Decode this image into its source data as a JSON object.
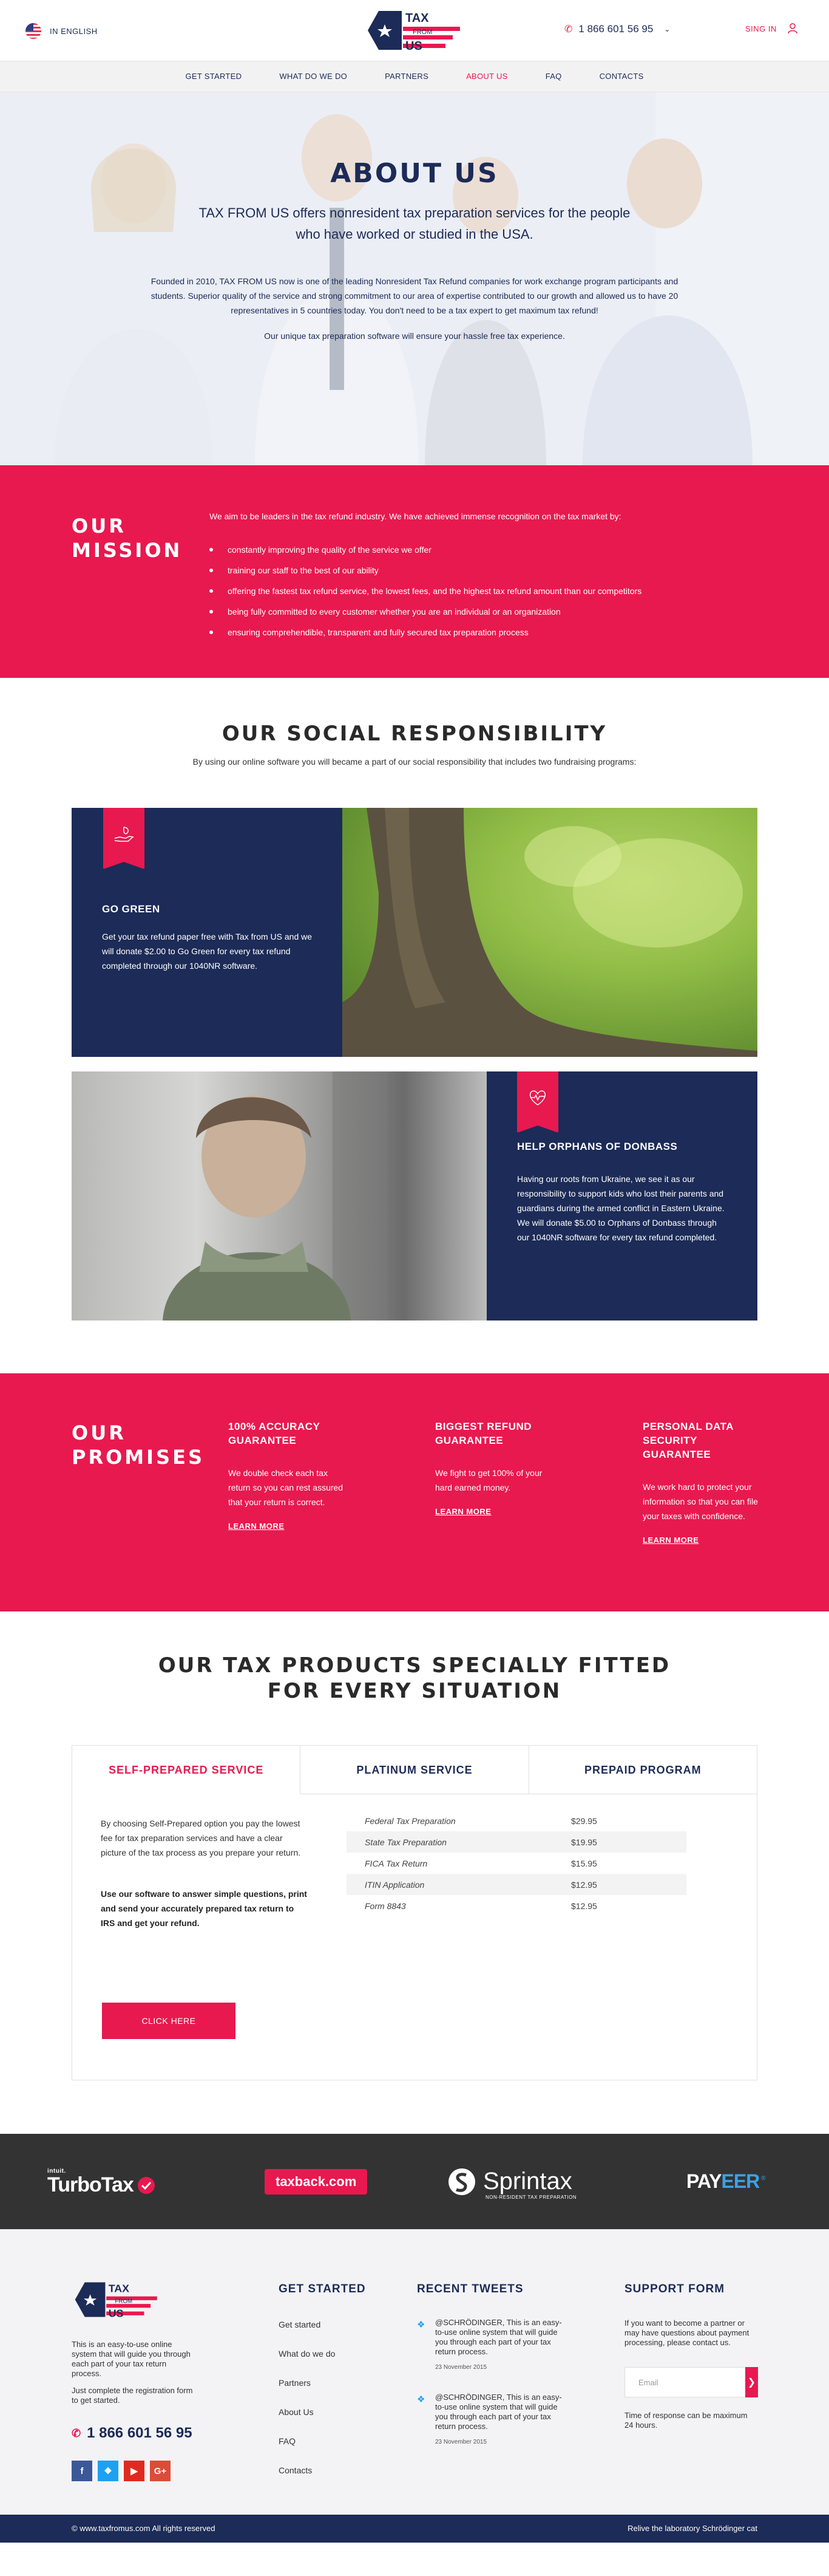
{
  "header": {
    "language": "IN ENGLISH",
    "logo": {
      "line1": "TAX",
      "line2": "FROM",
      "line3": "US"
    },
    "phone": "1 866 601 56 95",
    "sign_in": "SING IN"
  },
  "nav": {
    "items": [
      "GET STARTED",
      "WHAT DO WE DO",
      "PARTNERS",
      "ABOUT US",
      "FAQ",
      "CONTACTS"
    ],
    "active": "ABOUT US"
  },
  "hero": {
    "title": "ABOUT US",
    "lead": "TAX FROM US offers nonresident tax preparation services for the people who have worked or studied in the USA.",
    "paragraph": "Founded in 2010, TAX FROM US now is one of the leading Nonresident Tax Refund companies for work exchange program participants and students. Superior quality of the service and strong commitment to our area of expertise contributed to our growth and allowed us to have 20 representatives in 5 countries today. You don't need to be a tax expert to get maximum tax refund!",
    "paragraph2": "Our unique tax preparation software will ensure your hassle free tax experience."
  },
  "mission": {
    "title_line1": "OUR",
    "title_line2": "MISSION",
    "intro": "We aim to be leaders in the tax refund industry. We have achieved immense recognition on the tax market by:",
    "items": [
      "constantly improving the quality of the service we offer",
      "training our staff to the best of our ability",
      "offering the fastest tax refund service, the lowest fees, and the highest tax refund amount than our competitors",
      "being fully committed to every customer whether you are an individual or an organization",
      "ensuring comprehendible, transparent and fully secured tax preparation process"
    ]
  },
  "social": {
    "title": "OUR SOCIAL RESPONSIBILITY",
    "subtitle": "By using our online software you will became a part of our social responsibility that includes two fundraising programs:",
    "programs": [
      {
        "title": "GO GREEN",
        "text": "Get your tax refund paper free with Tax from US and we will donate $2.00 to Go Green for every tax refund completed through our 1040NR software."
      },
      {
        "title": "HELP ORPHANS OF DONBASS",
        "text": "Having our roots from Ukraine, we see it as our responsibility to support kids who lost their parents and guardians during the armed conflict in Eastern Ukraine. We will donate $5.00 to Orphans of Donbass through our 1040NR software for every tax refund completed."
      }
    ]
  },
  "promises": {
    "title_line1": "OUR",
    "title_line2": "PROMISES",
    "items": [
      {
        "title": "100% ACCURACY GUARANTEE",
        "text": "We double check each tax return so you can rest assured that your return is correct.",
        "link": "LEARN MORE"
      },
      {
        "title": "BIGGEST REFUND GUARANTEE",
        "text": "We fight to get 100% of your hard earned money.",
        "link": "LEARN MORE"
      },
      {
        "title": "PERSONAL DATA SECURITY GUARANTEE",
        "text": "We work hard to protect your information so that you can file your taxes with confidence.",
        "link": "LEARN MORE"
      }
    ]
  },
  "products": {
    "title_line1": "OUR TAX PRODUCTS SPECIALLY FITTED",
    "title_line2": "FOR EVERY SITUATION",
    "tabs": [
      "SELF-PREPARED SERVICE",
      "PLATINUM SERVICE",
      "PREPAID PROGRAM"
    ],
    "active_tab": "SELF-PREPARED SERVICE",
    "description": "By choosing Self-Prepared option you pay the lowest fee for tax preparation services and have a clear picture of the tax process as you prepare your return.",
    "description_bold": "Use our software to answer simple questions, print and send your accurately prepared tax return to IRS and get your refund.",
    "prices": [
      {
        "name": "Federal Tax Preparation",
        "price": "$29.95"
      },
      {
        "name": "State Tax Preparation",
        "price": "$19.95"
      },
      {
        "name": "FICA Tax Return",
        "price": "$15.95"
      },
      {
        "name": "ITIN Application",
        "price": "$12.95"
      },
      {
        "name": "Form 8843",
        "price": "$12.95"
      }
    ],
    "button": "CLICK HERE"
  },
  "partners": {
    "turbotax": {
      "prefix": "intuit.",
      "name": "TurboTax"
    },
    "taxback": "taxback.com",
    "sprintax": {
      "name": "Sprintax",
      "tagline": "NON-RESIDENT TAX PREPARATION"
    },
    "payeer": {
      "pay": "PAY",
      "eer": "EER"
    }
  },
  "footer": {
    "about": "This is an easy-to-use online system that will guide you through each part of your tax return process.",
    "note": "Just complete the registration form to get started.",
    "phone": "1 866 601 56 95",
    "get_started": {
      "title": "GET STARTED",
      "links": [
        "Get started",
        "What do we do",
        "Partners",
        "About Us",
        "FAQ",
        "Contacts"
      ]
    },
    "tweets": {
      "title": "RECENT TWEETS",
      "items": [
        {
          "text": "@SCHRÖDINGER, This is an easy-to-use online system that will guide you through each part of your tax return process.",
          "date": "23 November 2015"
        },
        {
          "text": "@SCHRÖDINGER, This is an easy-to-use online system that will guide you through each part of your tax return process.",
          "date": "23 November 2015"
        }
      ]
    },
    "support": {
      "title": "SUPPORT FORM",
      "desc": "If you want to become a partner or may have questions about payment processing, please contact us.",
      "email_placeholder": "Email",
      "time": "Time of response can be maximum 24 hours."
    },
    "copyright": "© www.taxfromus.com All rights reserved",
    "credit": "Relive the laboratory Schrödinger cat"
  }
}
